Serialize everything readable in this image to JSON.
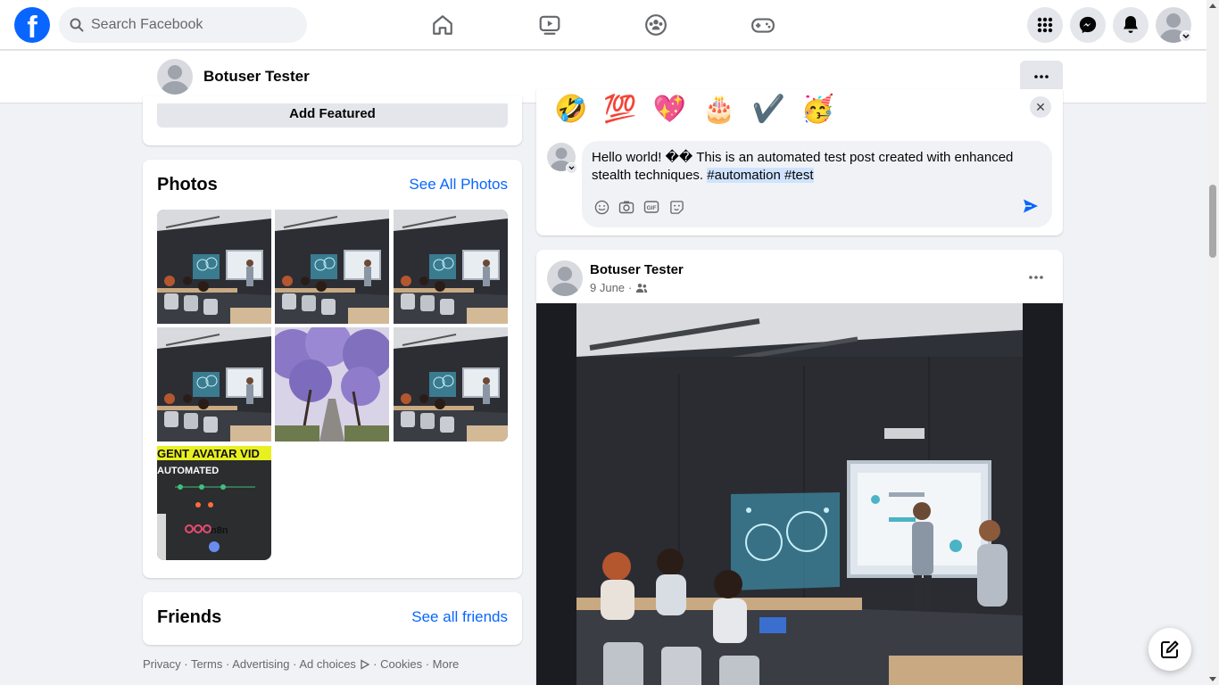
{
  "topbar": {
    "logo_letter": "f",
    "search_placeholder": "Search Facebook",
    "nav_icons": [
      "home-icon",
      "video-icon",
      "groups-icon",
      "gaming-icon"
    ],
    "right_icons": [
      "menu-grid-icon",
      "messenger-icon",
      "notifications-icon",
      "account-avatar"
    ]
  },
  "profile_bar": {
    "name": "Botuser Tester",
    "more_label": "···"
  },
  "featured": {
    "add_featured_label": "Add Featured"
  },
  "photos": {
    "title": "Photos",
    "see_all_label": "See All Photos",
    "items": [
      {
        "kind": "classroom"
      },
      {
        "kind": "classroom"
      },
      {
        "kind": "classroom"
      },
      {
        "kind": "classroom"
      },
      {
        "kind": "jacaranda"
      },
      {
        "kind": "classroom"
      },
      {
        "kind": "n8n"
      }
    ],
    "n8n_banner": "GENT AVATAR VID",
    "n8n_sub": "AUTOMATED",
    "n8n_logo": "n8n"
  },
  "friends": {
    "title": "Friends",
    "see_all_label": "See all friends"
  },
  "footer": {
    "links": [
      "Privacy",
      "Terms",
      "Advertising",
      "Ad choices",
      "Cookies",
      "More"
    ],
    "separator": " · "
  },
  "comment": {
    "emoji": [
      "🤣",
      "💯",
      "💖",
      "🎂",
      "✔️",
      "🥳"
    ],
    "text_plain": "Hello world! �� This is an automated test post created with enhanced stealth techniques. ",
    "hashtag1": "#automation",
    "hashtag2": "#test",
    "close_label": "✕"
  },
  "post": {
    "author": "Botuser Tester",
    "date": "9 June",
    "date_sep": " · ",
    "audience_icon": "friends-icon",
    "more_label": "···"
  },
  "colors": {
    "brand": "#0866ff",
    "page_bg": "#f0f2f5",
    "hashtag_highlight": "#cfe3ff"
  }
}
